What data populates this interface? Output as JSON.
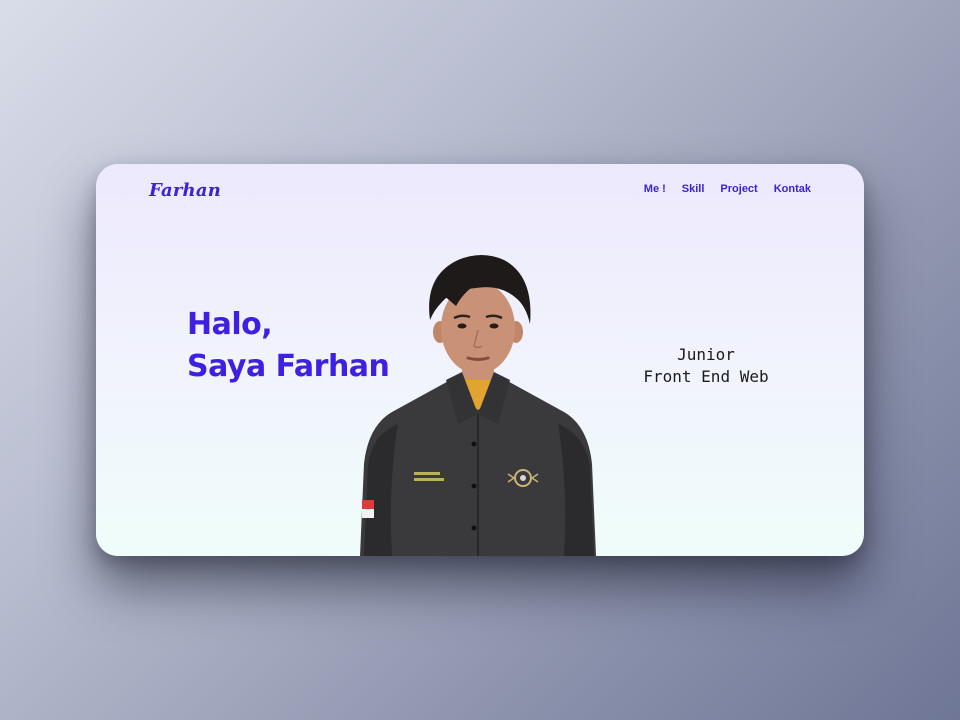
{
  "brand": {
    "logo_text": "Farhan",
    "accent_color": "#3b23d6"
  },
  "nav": {
    "items": [
      {
        "label": "Me !"
      },
      {
        "label": "Skill"
      },
      {
        "label": "Project"
      },
      {
        "label": "Kontak"
      }
    ]
  },
  "hero": {
    "greeting_line1": "Halo,",
    "greeting_line2": "Saya Farhan",
    "role_line1": "Junior",
    "role_line2": "Front End Web",
    "photo_icon": "person-portrait-photo"
  }
}
